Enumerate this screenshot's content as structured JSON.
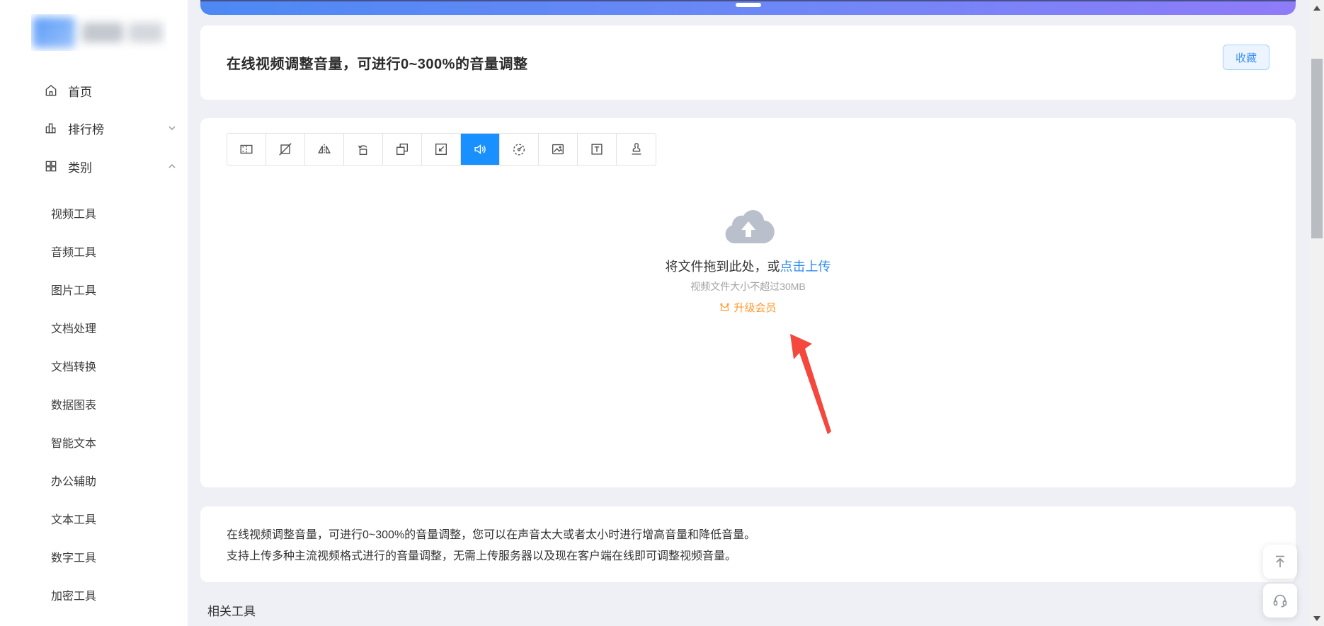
{
  "sidebar": {
    "items": [
      {
        "label": "首页",
        "icon": "home-icon"
      },
      {
        "label": "排行榜",
        "icon": "ranking-icon",
        "chevron": "down"
      },
      {
        "label": "类别",
        "icon": "category-icon",
        "chevron": "up"
      }
    ],
    "categories": [
      "视频工具",
      "音频工具",
      "图片工具",
      "文档处理",
      "文档转换",
      "数据图表",
      "智能文本",
      "办公辅助",
      "文本工具",
      "数字工具",
      "加密工具"
    ]
  },
  "header": {
    "title": "在线视频调整音量，可进行0~300%的音量调整",
    "favorite_label": "收藏"
  },
  "toolbar": {
    "active_index": 6,
    "tools": [
      {
        "icon": "clip-icon"
      },
      {
        "icon": "crop-icon"
      },
      {
        "icon": "flip-horizontal-icon"
      },
      {
        "icon": "rotate-icon"
      },
      {
        "icon": "resize-icon"
      },
      {
        "icon": "scale-icon"
      },
      {
        "icon": "volume-icon"
      },
      {
        "icon": "speed-icon"
      },
      {
        "icon": "image-watermark-icon"
      },
      {
        "icon": "text-icon"
      },
      {
        "icon": "stamp-icon"
      }
    ]
  },
  "upload": {
    "cloud_icon": "cloud-upload-icon",
    "drag_text": "将文件拖到此处，或",
    "click_text": "点击上传",
    "size_hint": "视频文件大小不超过30MB",
    "upgrade_icon": "crown-icon",
    "upgrade_label": "升级会员"
  },
  "description": {
    "line1": "在线视频调整音量，可进行0~300%的音量调整，您可以在声音太大或者太小时进行增高音量和降低音量。",
    "line2": "支持上传多种主流视频格式进行的音量调整，无需上传服务器以及现在客户端在线即可调整视频音量。"
  },
  "related": {
    "title": "相关工具"
  },
  "colors": {
    "accent": "#1890ff",
    "link_blue": "#2e8bf0",
    "upgrade_orange": "#ff9a2e",
    "arrow_red": "#f4473d",
    "gradient_start": "#4d89f3",
    "gradient_end": "#8f7bf8",
    "favorite_bg": "#ecf5ff",
    "favorite_border": "#a3d0fd"
  }
}
